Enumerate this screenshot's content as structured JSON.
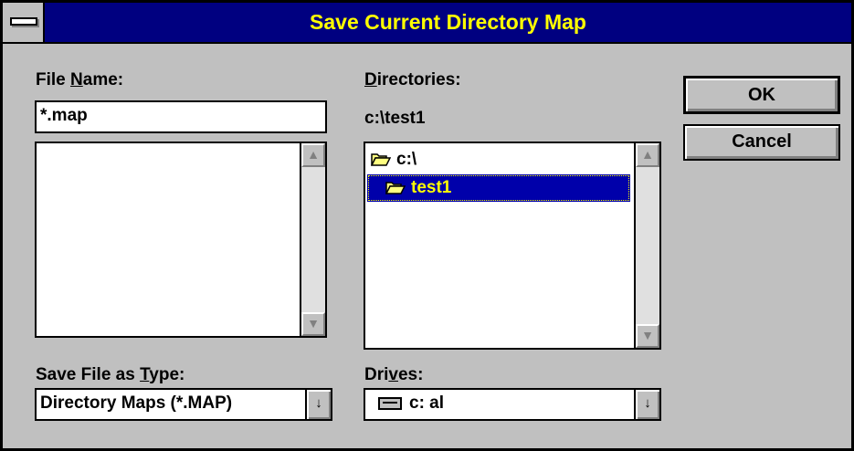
{
  "dialog": {
    "title": "Save Current Directory Map"
  },
  "file_name": {
    "label_pre": "File ",
    "label_underline": "N",
    "label_post": "ame:",
    "value": "*.map",
    "list_items": []
  },
  "directories": {
    "label_underline": "D",
    "label_post": "irectories:",
    "current_path": "c:\\test1",
    "items": [
      {
        "name": "c:\\",
        "icon": "open-folder-icon",
        "selected": false
      },
      {
        "name": "test1",
        "icon": "open-folder-icon",
        "selected": true
      }
    ]
  },
  "save_type": {
    "label_pre": "Save File as ",
    "label_underline": "T",
    "label_post": "ype:",
    "value": "Directory Maps (*.MAP)"
  },
  "drives": {
    "label_pre": "Dri",
    "label_underline": "v",
    "label_post": "es:",
    "value": "c: al",
    "icon": "hard-drive-icon"
  },
  "buttons": {
    "ok": "OK",
    "cancel": "Cancel"
  },
  "scroll": {
    "up_glyph": "▲",
    "down_glyph": "▼",
    "dropdown_glyph": "↓"
  },
  "colors": {
    "titlebar": "#000080",
    "title_text": "#ffff00",
    "selection": "#0000aa",
    "face": "#c0c0c0"
  }
}
